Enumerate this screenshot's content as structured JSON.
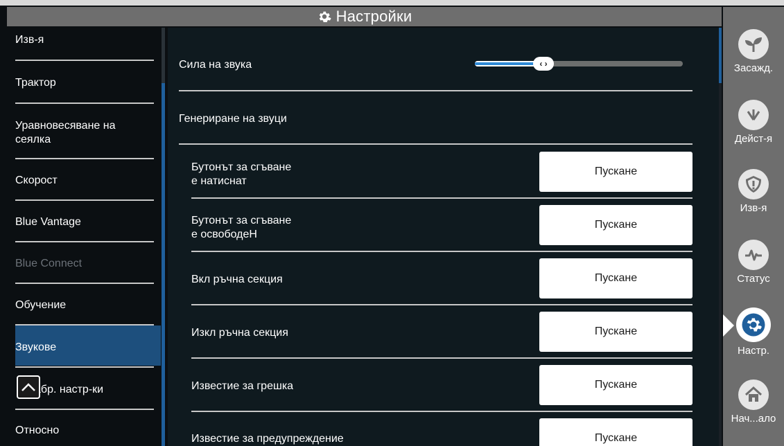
{
  "header": {
    "title": "Настройки",
    "icon": "gear-icon"
  },
  "sidebar": {
    "items": [
      {
        "label": "Изв-я",
        "state": "normal"
      },
      {
        "label": "Трактор",
        "state": "normal"
      },
      {
        "label": "Уравновесяване на сеялка",
        "state": "normal"
      },
      {
        "label": "Скорост",
        "state": "normal"
      },
      {
        "label": "Blue Vantage",
        "state": "normal"
      },
      {
        "label": "Blue Connect",
        "state": "disabled"
      },
      {
        "label": "Обучение",
        "state": "normal"
      },
      {
        "label": "Звукове",
        "state": "selected"
      },
      {
        "label": "абр. настр-ки",
        "state": "normal"
      },
      {
        "label": "Относно",
        "state": "normal"
      }
    ]
  },
  "main": {
    "volume_label": "Сила на звука",
    "volume_level_percent": 33,
    "volume_thumb_glyph": "‹ ›",
    "generate_sounds_label": "Генериране на звуци",
    "sound_rows": [
      {
        "label_line1": "Бутонът за сгъване",
        "label_line2": "е натиснат",
        "button": "Пускане"
      },
      {
        "label_line1": "Бутонът за сгъване",
        "label_line2": "е освободеН",
        "button": "Пускане"
      },
      {
        "label_line1": "Вкл ръчна секция",
        "label_line2": "",
        "button": "Пускане"
      },
      {
        "label_line1": "Изкл ръчна секция",
        "label_line2": "",
        "button": "Пускане"
      },
      {
        "label_line1": "Известие за грешка",
        "label_line2": "",
        "button": "Пускане"
      },
      {
        "label_line1": "Известие за предупреждение",
        "label_line2": "",
        "button": "Пускане"
      }
    ]
  },
  "rightnav": {
    "items": [
      {
        "label": "Засажд.",
        "icon": "seedling-icon",
        "active": false
      },
      {
        "label": "Дейст-я",
        "icon": "actions-icon",
        "active": false
      },
      {
        "label": "Изв-я",
        "icon": "alert-shield-icon",
        "active": false
      },
      {
        "label": "Статус",
        "icon": "pulse-icon",
        "active": false
      },
      {
        "label": "Настр.",
        "icon": "gear-icon",
        "active": true
      },
      {
        "label": "Нач...ало",
        "icon": "home-icon",
        "active": false
      }
    ]
  },
  "colors": {
    "accent": "#1f5f9c",
    "selected_bg": "#1d4f7d",
    "panel_bg": "#0f1a1f",
    "nav_bg": "#6e6e6e"
  }
}
